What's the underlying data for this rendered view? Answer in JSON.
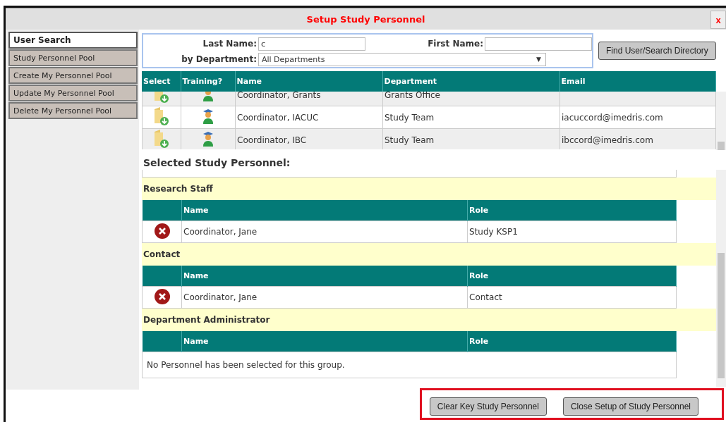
{
  "window": {
    "title": "Setup Study Personnel",
    "close": "x"
  },
  "sidebar": {
    "items": [
      {
        "label": "User Search",
        "selected": true
      },
      {
        "label": "Study Personnel Pool",
        "selected": false
      },
      {
        "label": "Create My Personnel Pool",
        "selected": false
      },
      {
        "label": "Update My Personnel Pool",
        "selected": false
      },
      {
        "label": "Delete My Personnel Pool",
        "selected": false
      }
    ]
  },
  "search": {
    "last_name_label": "Last Name:",
    "last_name": "c",
    "first_name_label": "First Name:",
    "department_label": "by Department:",
    "department": "All Departments",
    "dropdown_arrow": "▼",
    "button": "Find User/Search Directory"
  },
  "results": {
    "columns": [
      "Select",
      "Training?",
      "Name",
      "Department",
      "Email"
    ],
    "rows": [
      {
        "name": "Coordinator, Grants",
        "department": "Grants Office"
      },
      {
        "name": "Coordinator, IACUC",
        "department": "Study Team",
        "email": "iacuccord@imedris.com"
      },
      {
        "name": "Coordinator, IBC",
        "department": "Study Team",
        "email": "ibccord@imedris.com"
      }
    ]
  },
  "selected": {
    "title": "Selected Study Personnel:",
    "groups": [
      {
        "title": "Research Staff",
        "columns": [
          "Name",
          "Role"
        ],
        "rows": [
          {
            "name": "Coordinator, Jane",
            "role": "Study KSP1"
          }
        ]
      },
      {
        "title": "Contact",
        "columns": [
          "Name",
          "Role"
        ],
        "rows": [
          {
            "name": "Coordinator, Jane",
            "role": "Contact"
          }
        ]
      },
      {
        "title": "Department Administrator",
        "columns": [
          "Name",
          "Role"
        ],
        "empty_message": "No Personnel has been selected for this group."
      }
    ]
  },
  "buttons": [
    "Clear Key Study Personnel",
    "Close Setup of Study Personnel"
  ]
}
